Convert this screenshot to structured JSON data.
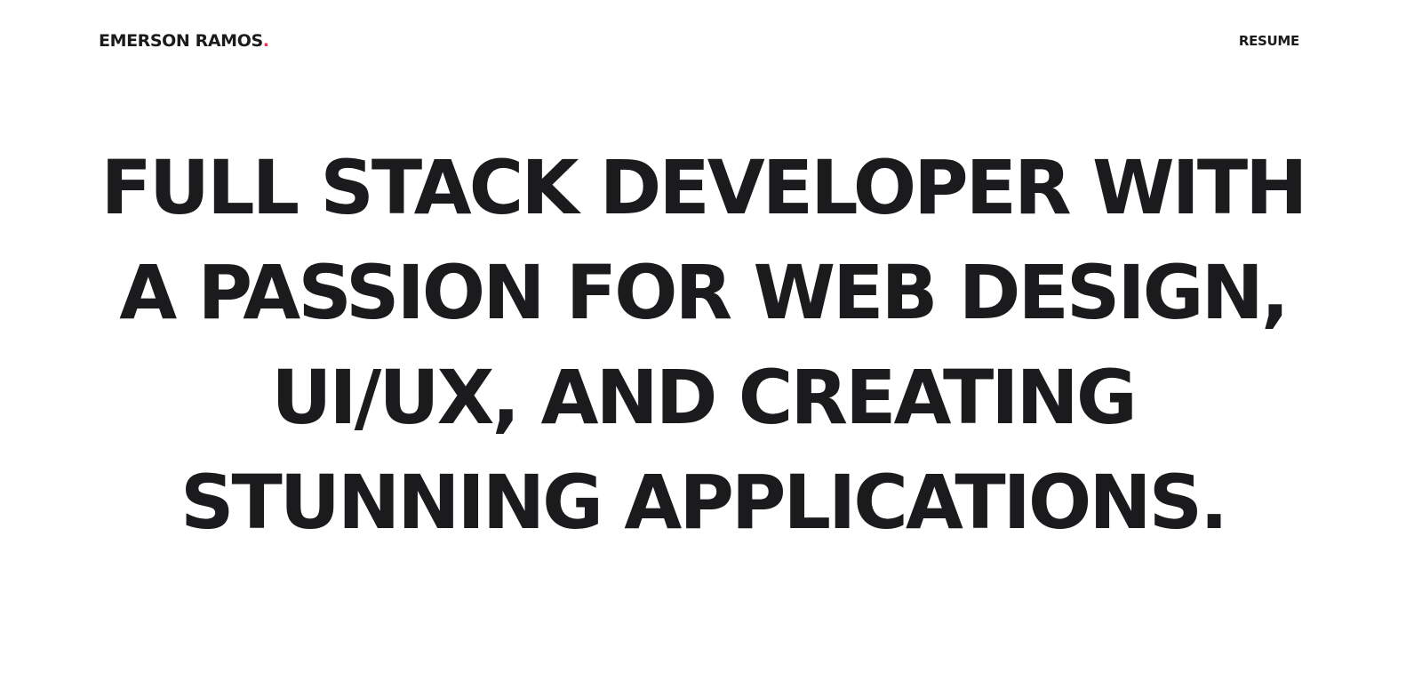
{
  "header": {
    "logo_name": "EMERSON RAMOS",
    "logo_dot": ".",
    "resume_label": "RESUME"
  },
  "hero": {
    "lines": [
      "FULL STACK DEVELOPER WITH",
      "A PASSION FOR WEB DESIGN,",
      "UI/UX, AND CREATING",
      "STUNNING APPLICATIONS."
    ]
  },
  "colors": {
    "text": "#1b1b1d",
    "accent": "#ff2d55",
    "background": "#ffffff"
  }
}
